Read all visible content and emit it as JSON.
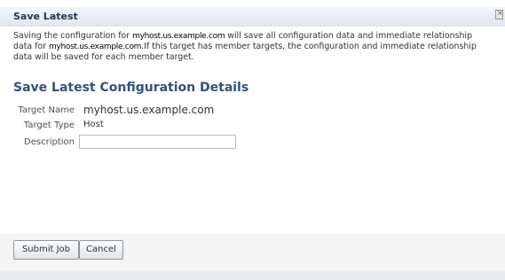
{
  "dialog": {
    "title": "Save Latest",
    "close_glyph": "×",
    "close_icon": "close-icon",
    "description": {
      "part1": "Saving the configuration for ",
      "host1": "myhost.us.example.com",
      "part2": " will save all configuration data and immediate relationship data for ",
      "host2": "myhost.us.example.com",
      "part3": ".If this target has member targets, the configuration and immediate relationship data will be saved for each member target."
    }
  },
  "details": {
    "header": "Save Latest Configuration Details",
    "target_name_label": "Target Name",
    "target_name_value": "myhost.us.example.com",
    "target_type_label": "Target Type",
    "target_type_value": "Host",
    "description_label": "Description",
    "description_value": ""
  },
  "buttons": {
    "submit": "Submit Job",
    "cancel": "Cancel"
  },
  "colors": {
    "title_text": "#1f3652",
    "section_header": "#34517d",
    "title_bar": "#dfe6ee"
  }
}
